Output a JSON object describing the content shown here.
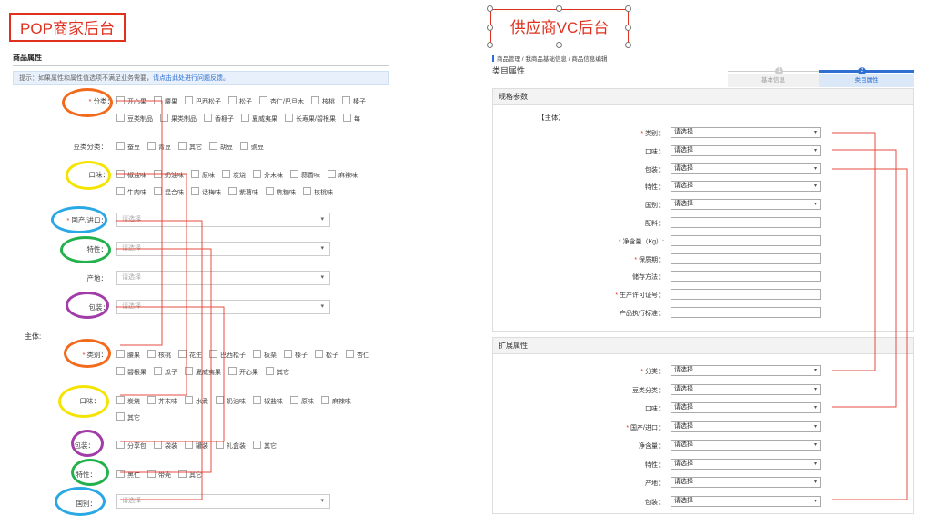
{
  "pop": {
    "title": "POP商家后台",
    "section_title": "商品属性",
    "tip": "提示：如果属性和属性值选项不满足业务需要，",
    "tip_link": "请点击此处进行问题反馈。",
    "rows": {
      "category": {
        "label": "分类：",
        "options": [
          "开心果",
          "腰果",
          "巴西松子",
          "松子",
          "杏仁/巴旦木",
          "核桃",
          "榛子",
          "豆类制品",
          "果类制品",
          "香榧子",
          "夏威夷果",
          "长寿果/碧根果",
          "每"
        ]
      },
      "bean": {
        "label": "豆类分类：",
        "options": [
          "蚕豆",
          "青豆",
          "其它",
          "胡豆",
          "豌豆"
        ]
      },
      "flavor": {
        "label": "口味：",
        "options": [
          "椒盐味",
          "奶油味",
          "原味",
          "炭烧",
          "芥末味",
          "蒜香味",
          "麻辣味",
          "牛肉味",
          "混合味",
          "话梅味",
          "紫薯味",
          "焦糖味",
          "核桃味"
        ]
      },
      "origin": {
        "label": "国产/进口：",
        "placeholder": "请选择"
      },
      "feature": {
        "label": "特性：",
        "placeholder": "请选择"
      },
      "place": {
        "label": "产地：",
        "placeholder": "请选择"
      },
      "package": {
        "label": "包装：",
        "placeholder": "请选择"
      }
    },
    "main_label": "主体:",
    "main_rows": {
      "category": {
        "label": "类别：",
        "options": [
          "腰果",
          "核桃",
          "花生",
          "巴西松子",
          "板栗",
          "榛子",
          "松子",
          "杏仁",
          "碧根果",
          "瓜子",
          "夏威夷果",
          "开心果",
          "其它"
        ]
      },
      "flavor": {
        "label": "口味：",
        "options": [
          "炭烧",
          "芥末味",
          "水煮",
          "奶油味",
          "椒盐味",
          "原味",
          "麻辣味",
          "其它"
        ]
      },
      "package": {
        "label": "包装：",
        "options": [
          "分享包",
          "袋装",
          "罐装",
          "礼盒装",
          "其它"
        ]
      },
      "feature": {
        "label": "特性：",
        "options": [
          "黑仁",
          "带壳",
          "其它"
        ]
      },
      "country": {
        "label": "国别：",
        "placeholder": "请选择"
      }
    }
  },
  "vc": {
    "title": "供应商VC后台",
    "breadcrumb": "商品管理 / 我商品基础信息 / 商品信息编辑",
    "page_title": "类目属性",
    "steps": [
      {
        "num": "1",
        "label": "基本信息"
      },
      {
        "num": "2",
        "label": "类目属性"
      }
    ],
    "spec_title": "规格参数",
    "main_tag": "【主体】",
    "spec_rows": [
      {
        "label": "类别：",
        "required": true,
        "value": "请选择",
        "type": "select"
      },
      {
        "label": "口味：",
        "required": false,
        "value": "请选择",
        "type": "select"
      },
      {
        "label": "包装：",
        "required": false,
        "value": "请选择",
        "type": "select"
      },
      {
        "label": "特性：",
        "required": false,
        "value": "请选择",
        "type": "select"
      },
      {
        "label": "国别：",
        "required": false,
        "value": "请选择",
        "type": "select"
      },
      {
        "label": "配料：",
        "required": false,
        "value": "",
        "type": "input"
      },
      {
        "label": "净含量（Kg）:",
        "required": true,
        "value": "",
        "type": "input"
      },
      {
        "label": "保质期：",
        "required": true,
        "value": "",
        "type": "input"
      },
      {
        "label": "储存方法：",
        "required": false,
        "value": "",
        "type": "input"
      },
      {
        "label": "生产许可证号：",
        "required": true,
        "value": "",
        "type": "input"
      },
      {
        "label": "产品执行标准：",
        "required": false,
        "value": "",
        "type": "input"
      }
    ],
    "ext_title": "扩展属性",
    "ext_rows": [
      {
        "label": "分类：",
        "required": true,
        "value": "请选择"
      },
      {
        "label": "豆类分类：",
        "required": false,
        "value": "请选择"
      },
      {
        "label": "口味：",
        "required": false,
        "value": "请选择"
      },
      {
        "label": "国产/进口：",
        "required": true,
        "value": "请选择"
      },
      {
        "label": "净含量：",
        "required": false,
        "value": "请选择"
      },
      {
        "label": "特性：",
        "required": false,
        "value": "请选择"
      },
      {
        "label": "产地：",
        "required": false,
        "value": "请选择"
      },
      {
        "label": "包装：",
        "required": false,
        "value": "请选择"
      }
    ]
  },
  "colors": {
    "red": "#e0301e",
    "orange": "#f26a1b",
    "yellow": "#f5e400",
    "blue": "#29a8e6",
    "green": "#22b14c",
    "purple": "#a23ca8",
    "link": "#2f6fd1"
  }
}
